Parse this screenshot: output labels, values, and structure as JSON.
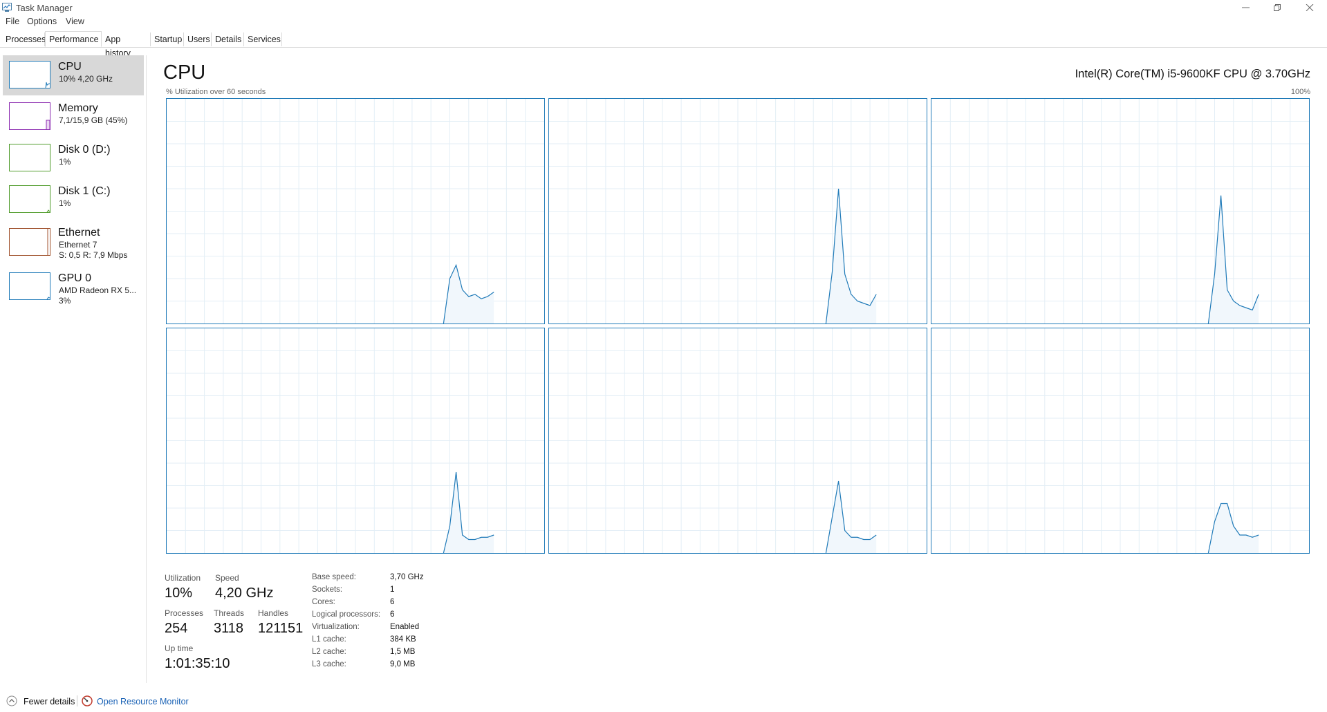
{
  "window": {
    "title": "Task Manager",
    "minimize": "–",
    "restore": "❐",
    "close": "✕"
  },
  "menu": [
    "File",
    "Options",
    "View"
  ],
  "tabs": [
    {
      "label": "Processes",
      "active": false
    },
    {
      "label": "Performance",
      "active": true
    },
    {
      "label": "App history",
      "active": false
    },
    {
      "label": "Startup",
      "active": false
    },
    {
      "label": "Users",
      "active": false
    },
    {
      "label": "Details",
      "active": false
    },
    {
      "label": "Services",
      "active": false
    }
  ],
  "sidebar": [
    {
      "name": "CPU",
      "line1": "10% 4,20 GHz",
      "line2": "",
      "color": "#1f7ab8",
      "active": true
    },
    {
      "name": "Memory",
      "line1": "7,1/15,9 GB (45%)",
      "line2": "",
      "color": "#8b2bb0",
      "active": false
    },
    {
      "name": "Disk 0 (D:)",
      "line1": "1%",
      "line2": "",
      "color": "#4f9b2a",
      "active": false
    },
    {
      "name": "Disk 1 (C:)",
      "line1": "1%",
      "line2": "",
      "color": "#4f9b2a",
      "active": false
    },
    {
      "name": "Ethernet",
      "line1": "Ethernet 7",
      "line2": "S: 0,5 R: 7,9 Mbps",
      "color": "#a0522d",
      "active": false
    },
    {
      "name": "GPU 0",
      "line1": "AMD Radeon RX 5...",
      "line2": "3%",
      "color": "#1f7ab8",
      "active": false
    }
  ],
  "main": {
    "title": "CPU",
    "model": "Intel(R) Core(TM) i5-9600KF CPU @ 3.70GHz",
    "graph_label": "% Utilization over 60 seconds",
    "graph_max": "100%",
    "graph_color": "#1f7ab8"
  },
  "chart_data": {
    "type": "area",
    "title": "% Utilization over 60 seconds",
    "ylim": [
      0,
      100
    ],
    "xlim": [
      0,
      60
    ],
    "grid": true,
    "x": [
      0,
      44,
      45,
      46,
      47,
      48,
      49,
      50,
      51,
      52
    ],
    "series": [
      {
        "values": [
          0,
          0,
          20,
          26,
          15,
          12,
          13,
          11,
          12,
          14
        ]
      },
      {
        "values": [
          0,
          0,
          23,
          60,
          22,
          13,
          10,
          9,
          8,
          13
        ]
      },
      {
        "values": [
          0,
          0,
          22,
          57,
          15,
          10,
          8,
          7,
          6,
          13
        ]
      },
      {
        "values": [
          0,
          0,
          12,
          36,
          8,
          6,
          6,
          7,
          7,
          8
        ]
      },
      {
        "values": [
          0,
          0,
          16,
          32,
          10,
          7,
          7,
          6,
          6,
          8
        ]
      },
      {
        "values": [
          0,
          0,
          14,
          22,
          22,
          12,
          8,
          8,
          7,
          8
        ]
      }
    ]
  },
  "stats": {
    "utilization_label": "Utilization",
    "utilization": "10%",
    "speed_label": "Speed",
    "speed": "4,20 GHz",
    "processes_label": "Processes",
    "processes": "254",
    "threads_label": "Threads",
    "threads": "3118",
    "handles_label": "Handles",
    "handles": "121151",
    "uptime_label": "Up time",
    "uptime": "1:01:35:10"
  },
  "specs": [
    {
      "key": "Base speed:",
      "value": "3,70 GHz"
    },
    {
      "key": "Sockets:",
      "value": "1"
    },
    {
      "key": "Cores:",
      "value": "6"
    },
    {
      "key": "Logical processors:",
      "value": "6"
    },
    {
      "key": "Virtualization:",
      "value": "Enabled"
    },
    {
      "key": "L1 cache:",
      "value": "384 KB"
    },
    {
      "key": "L2 cache:",
      "value": "1,5 MB"
    },
    {
      "key": "L3 cache:",
      "value": "9,0 MB"
    }
  ],
  "footer": {
    "fewer_details": "Fewer details",
    "resource_monitor": "Open Resource Monitor"
  }
}
